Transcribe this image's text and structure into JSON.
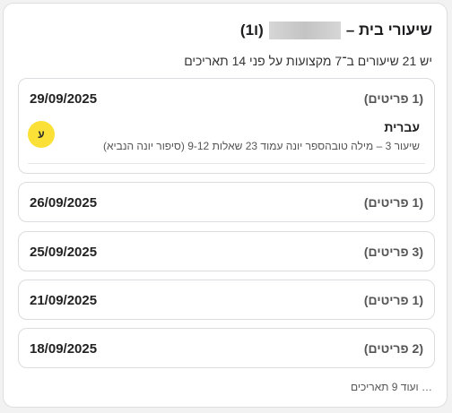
{
  "header": {
    "title_prefix": "שיעורי בית –",
    "title_suffix": "(ו1)",
    "summary": "יש 21 שיעורים ב־7 מקצועות על פני 14 תאריכים"
  },
  "groups": [
    {
      "date": "29/09/2025",
      "count_label": "(1 פריטים)",
      "expanded": true,
      "items": [
        {
          "subject": "עברית",
          "description": "שיעור 3 – מילה טובהספר יונה עמוד 23 שאלות 9-12 (סיפור יונה הנביא)",
          "badge": "ע",
          "badge_color": "#fbe137"
        }
      ]
    },
    {
      "date": "26/09/2025",
      "count_label": "(1 פריטים)",
      "expanded": false
    },
    {
      "date": "25/09/2025",
      "count_label": "(3 פריטים)",
      "expanded": false
    },
    {
      "date": "21/09/2025",
      "count_label": "(1 פריטים)",
      "expanded": false
    },
    {
      "date": "18/09/2025",
      "count_label": "(2 פריטים)",
      "expanded": false
    }
  ],
  "more_label": "… ועוד 9 תאריכים"
}
